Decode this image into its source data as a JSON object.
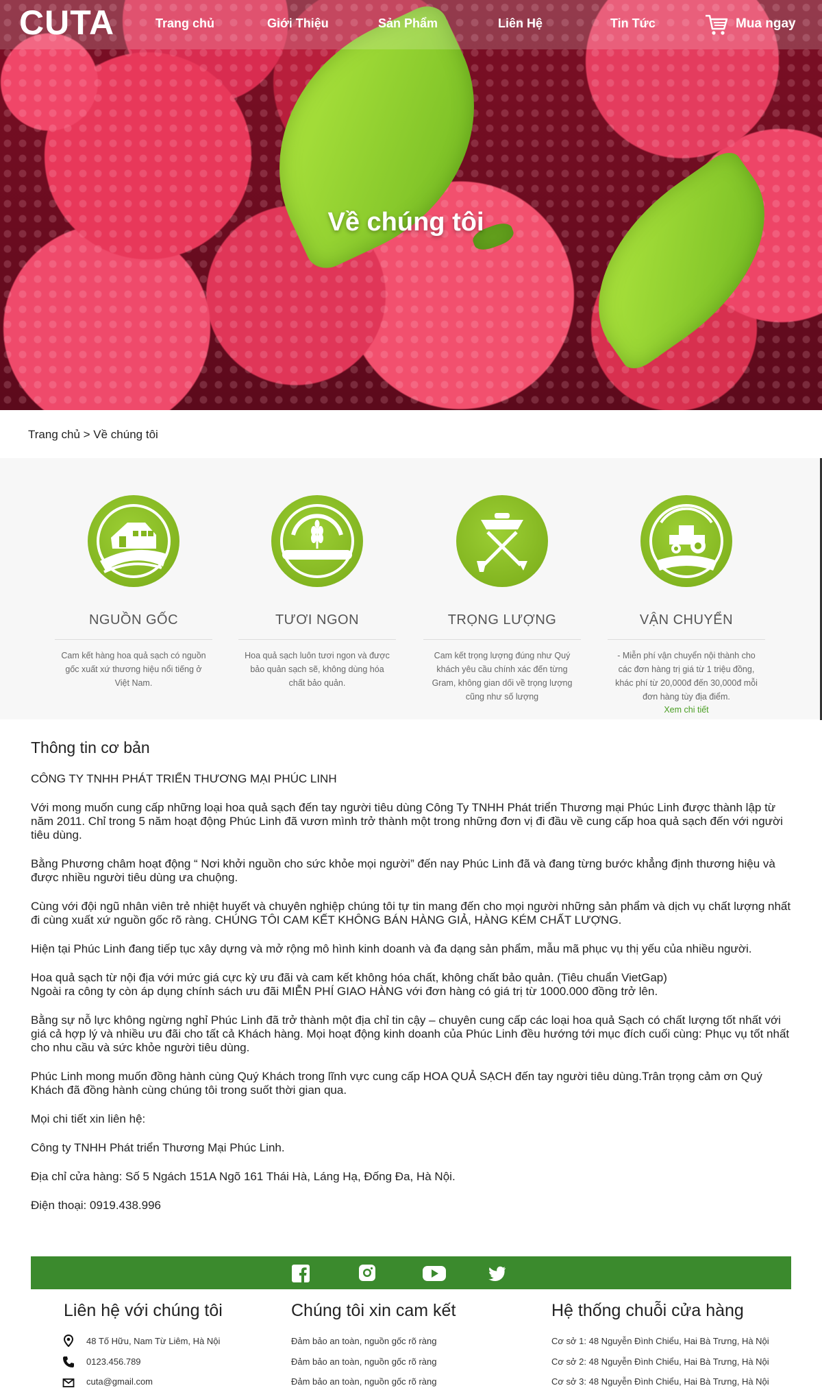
{
  "brand": {
    "logo": "CUTA"
  },
  "nav": {
    "items": [
      "Trang chủ",
      "Giới Thiệu",
      "Sản Phẩm",
      "Liên Hệ",
      "Tin Tức"
    ],
    "buy_label": "Mua ngay"
  },
  "hero": {
    "title": "Về chúng tôi"
  },
  "breadcrumb": {
    "text": "Trang chủ > Về chúng tôi"
  },
  "features": [
    {
      "title": "NGUỒN GỐC",
      "desc": "Cam kết hàng hoa quả sạch có nguồn gốc xuất xứ thương hiệu nổi tiếng ở Việt Nam.",
      "icon": "farm-house-icon"
    },
    {
      "title": "TƯƠI NGON",
      "desc": "Hoa quả sạch luôn tươi ngon và được bảo quản sạch sẽ, không dùng hóa chất bảo quản.",
      "icon": "wheat-icon"
    },
    {
      "title": "TRỌNG LƯỢNG",
      "desc": "Cam kết trọng lượng đúng như Quý khách yêu cầu chính xác đến từng Gram, không gian dối về trọng lượng cũng như số lượng",
      "icon": "tools-icon"
    },
    {
      "title": "VẬN CHUYỂN",
      "desc": "- Miễn phí vận chuyển nội thành cho các đơn hàng trị giá từ 1 triệu đồng, khác phí từ 20,000đ đến 30,000đ mỗi đơn hàng tùy địa điểm.",
      "more": "Xem chi tiết",
      "icon": "tractor-icon"
    }
  ],
  "about": {
    "heading": "Thông tin cơ bản",
    "company": "CÔNG TY TNHH PHÁT TRIỂN THƯƠNG MẠI PHÚC LINH",
    "p1": "Với mong muốn cung cấp những loại hoa quả sạch đến tay người tiêu dùng Công Ty TNHH Phát triển Thương mại Phúc Linh được thành lập từ năm 2011.  Chỉ trong 5 năm hoạt động Phúc Linh đã vươn mình trở thành một trong những đơn vị đi đầu về cung cấp hoa quả sạch đến với người tiêu dùng.",
    "p2": "Bằng Phương châm hoạt động “ Nơi khởi nguồn cho sức khỏe mọi người” đến nay Phúc Linh đã và đang từng bước khẳng định thương hiệu và được nhiều người tiêu dùng ưa chuộng.",
    "p3": "Cùng với đội ngũ nhân viên trẻ nhiệt huyết và chuyên nghiệp chúng tôi tự tin mang đến cho mọi người những sản phẩm và dịch vụ chất lượng nhất đi cùng xuất xứ nguồn gốc rõ ràng. CHÚNG TÔI CAM KẾT KHÔNG BÁN HÀNG GIẢ, HÀNG KÉM CHẤT LƯỢNG.",
    "p4": "Hiện tại Phúc Linh đang tiếp tục xây dựng và mở rộng mô hình kinh doanh và đa dạng sản phẩm, mẫu mã phục vụ thị yếu của nhiều người.",
    "p5a": "Hoa quả sạch từ nội địa với mức giá cực kỳ ưu đãi và cam kết không hóa chất, không chất bảo quản. (Tiêu chuẩn VietGap)",
    "p5b": "Ngoài ra công ty còn áp dụng chính sách ưu đãi MIỄN PHÍ GIAO HÀNG với đơn hàng có giá trị từ 1000.000 đồng trở lên.",
    "p6": "Bằng sự nỗ lực không ngừng nghỉ Phúc Linh đã trở thành một địa chỉ tin cậy – chuyên cung cấp các loại hoa quả Sạch có chất lượng tốt nhất với giá cả hợp lý và nhiều ưu đãi cho tất cả Khách hàng. Mọi hoạt động kinh doanh của Phúc Linh đều hướng tới mục đích cuối cùng: Phục vụ tốt nhất cho nhu cầu và sức khỏe người tiêu dùng.",
    "p7": "Phúc Linh mong muốn đồng hành cùng Quý Khách trong lĩnh vực cung cấp HOA QUẢ SẠCH đến tay người tiêu dùng.Trân trọng cảm ơn Quý Khách đã đồng hành cùng chúng tôi trong suốt thời gian qua.",
    "p8": "Mọi chi tiết xin liên hệ:",
    "p9": "Công ty TNHH Phát triển Thương Mại Phúc Linh.",
    "p10": "Địa chỉ cửa hàng: Số 5 Ngách 151A Ngõ 161 Thái Hà, Láng Hạ, Đống Đa, Hà Nội.",
    "p11": "Điện thoại: 0919.438.996"
  },
  "colors": {
    "accent_green": "#3b8a2d",
    "icon_green": "#8bbd26"
  },
  "footer": {
    "contact": {
      "title": "Liên hệ với chúng tôi",
      "address": "48 Tố Hữu, Nam Từ Liêm, Hà Nội",
      "phone": "0123.456.789",
      "email": "cuta@gmail.com"
    },
    "commit": {
      "title": "Chúng tôi xin cam kết",
      "items": [
        "Đảm bảo an toàn, nguồn gốc rõ ràng",
        "Đảm bảo an toàn, nguồn gốc rõ ràng",
        "Đảm bảo an toàn, nguồn gốc rõ ràng"
      ]
    },
    "stores": {
      "title": "Hệ thống chuỗi cửa hàng",
      "items": [
        "Cơ sở 1: 48 Nguyễn Đình Chiểu, Hai Bà Trưng, Hà Nội",
        "Cơ sở 2: 48 Nguyễn Đình Chiểu, Hai Bà Trưng, Hà Nội",
        "Cơ sở 3: 48 Nguyễn Đình Chiểu, Hai Bà Trưng, Hà Nội"
      ]
    }
  }
}
